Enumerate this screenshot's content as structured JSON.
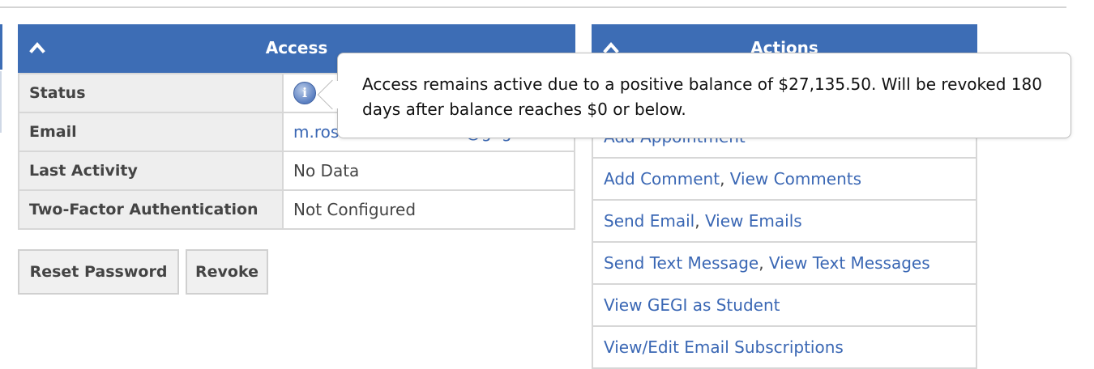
{
  "access": {
    "title": "Access",
    "rows": [
      {
        "label": "Status",
        "value": ""
      },
      {
        "label": "Email",
        "value": "m.rosenthal+rcdemo@gegi.co"
      },
      {
        "label": "Last Activity",
        "value": "No Data"
      },
      {
        "label": "Two-Factor Authentication",
        "value": "Not Configured"
      }
    ],
    "status_icon": "info-icon",
    "buttons": {
      "reset": "Reset Password",
      "revoke": "Revoke"
    }
  },
  "actions": {
    "title": "Actions",
    "items": [
      {
        "links": [
          "Add Appointment"
        ]
      },
      {
        "links": [
          "Add Comment",
          "View Comments"
        ]
      },
      {
        "links": [
          "Send Email",
          "View Emails"
        ]
      },
      {
        "links": [
          "Send Text Message",
          "View Text Messages"
        ]
      },
      {
        "links": [
          "View GEGI as Student"
        ]
      },
      {
        "links": [
          "View/Edit Email Subscriptions"
        ]
      }
    ],
    "separator": ", "
  },
  "tooltip": {
    "text": "Access remains active due to a positive balance of $27,135.50. Will be revoked 180 days after balance reaches $0 or below."
  },
  "colors": {
    "header_bg": "#3d6db5",
    "link": "#3a67b4"
  }
}
